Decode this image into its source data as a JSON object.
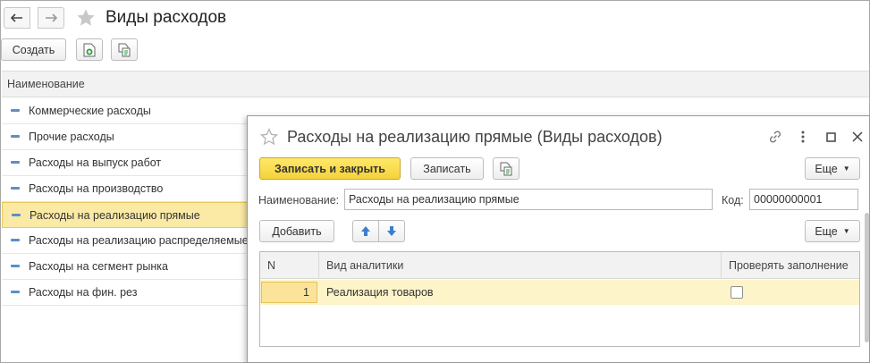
{
  "main": {
    "title": "Виды расходов",
    "create_label": "Создать",
    "column_header": "Наименование",
    "items": [
      {
        "label": "Коммерческие расходы"
      },
      {
        "label": "Прочие расходы"
      },
      {
        "label": "Расходы на выпуск работ"
      },
      {
        "label": "Расходы на производство"
      },
      {
        "label": "Расходы на реализацию прямые",
        "selected": true
      },
      {
        "label": "Расходы на реализацию распределяемые"
      },
      {
        "label": "Расходы на сегмент рынка"
      },
      {
        "label": "Расходы на фин. рез"
      }
    ]
  },
  "form": {
    "title": "Расходы на реализацию прямые (Виды расходов)",
    "save_close_label": "Записать и закрыть",
    "save_label": "Записать",
    "more_label": "Еще",
    "name_label": "Наименование:",
    "name_value": "Расходы на реализацию прямые",
    "code_label": "Код:",
    "code_value": "00000000001",
    "add_label": "Добавить",
    "table": {
      "columns": [
        "N",
        "Вид аналитики",
        "Проверять заполнение"
      ],
      "rows": [
        {
          "n": "1",
          "kind": "Реализация товаров",
          "check": false
        }
      ]
    }
  },
  "colors": {
    "accent_yellow": "#f5d23a",
    "selection": "#fbeaa5",
    "marker_blue": "#5b8fc7"
  },
  "icons": [
    "arrow-left-icon",
    "arrow-right-icon",
    "star-icon",
    "add-copy-icon",
    "doc-report-icon",
    "link-icon",
    "more-vertical-icon",
    "maximize-icon",
    "close-icon",
    "arrow-up-icon",
    "arrow-down-icon"
  ]
}
